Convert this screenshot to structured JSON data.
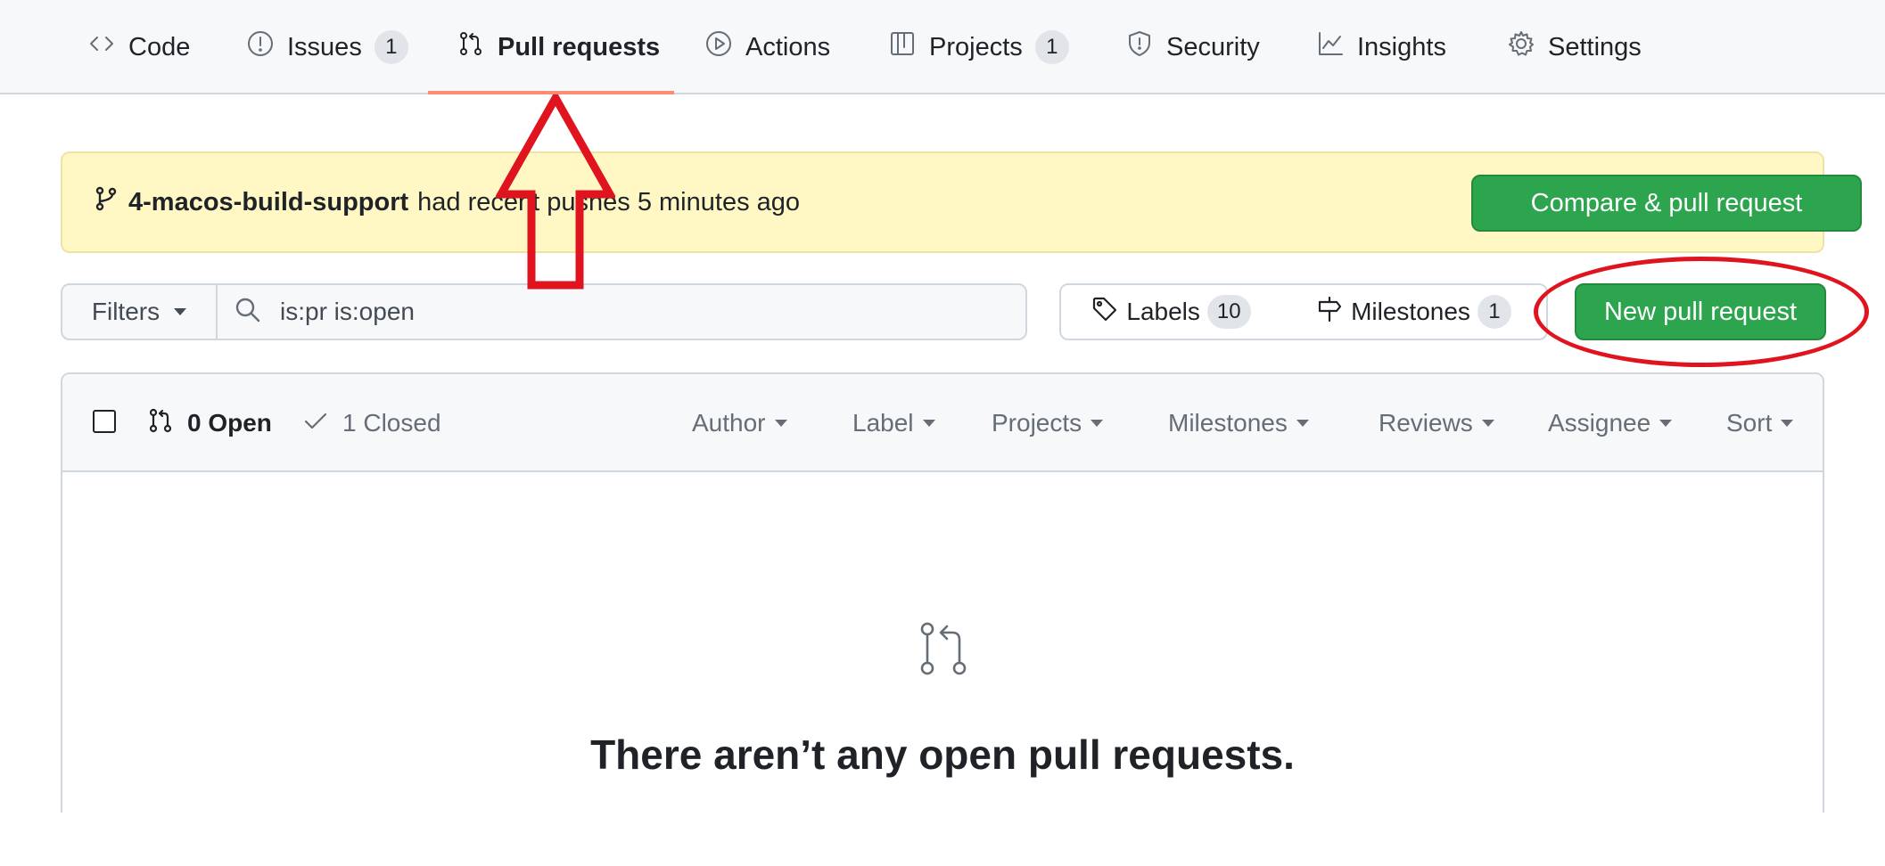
{
  "nav": {
    "tabs": [
      {
        "label": "Code",
        "icon": "code-icon"
      },
      {
        "label": "Issues",
        "icon": "issue-icon",
        "count": "1"
      },
      {
        "label": "Pull requests",
        "icon": "pull-request-icon",
        "active": true
      },
      {
        "label": "Actions",
        "icon": "play-icon"
      },
      {
        "label": "Projects",
        "icon": "table-icon",
        "count": "1"
      },
      {
        "label": "Security",
        "icon": "shield-icon"
      },
      {
        "label": "Insights",
        "icon": "graph-icon"
      },
      {
        "label": "Settings",
        "icon": "gear-icon"
      }
    ]
  },
  "flash": {
    "branch": "4-macos-build-support",
    "message": "had recent pushes 5 minutes ago",
    "button_label": "Compare & pull request"
  },
  "filter_bar": {
    "filters_label": "Filters",
    "search_value": "is:pr is:open",
    "labels_label": "Labels",
    "labels_count": "10",
    "milestones_label": "Milestones",
    "milestones_count": "1",
    "new_pr_label": "New pull request"
  },
  "list": {
    "open_label": "0 Open",
    "closed_label": "1 Closed",
    "sort_menus": [
      "Author",
      "Label",
      "Projects",
      "Milestones",
      "Reviews",
      "Assignee",
      "Sort"
    ],
    "blankslate_title": "There aren’t any open pull requests."
  },
  "colors": {
    "accent_green": "#2da44e",
    "tab_underline": "#fd8c73",
    "flash_bg": "#fff8c5",
    "annotation_red": "#e0141e"
  }
}
